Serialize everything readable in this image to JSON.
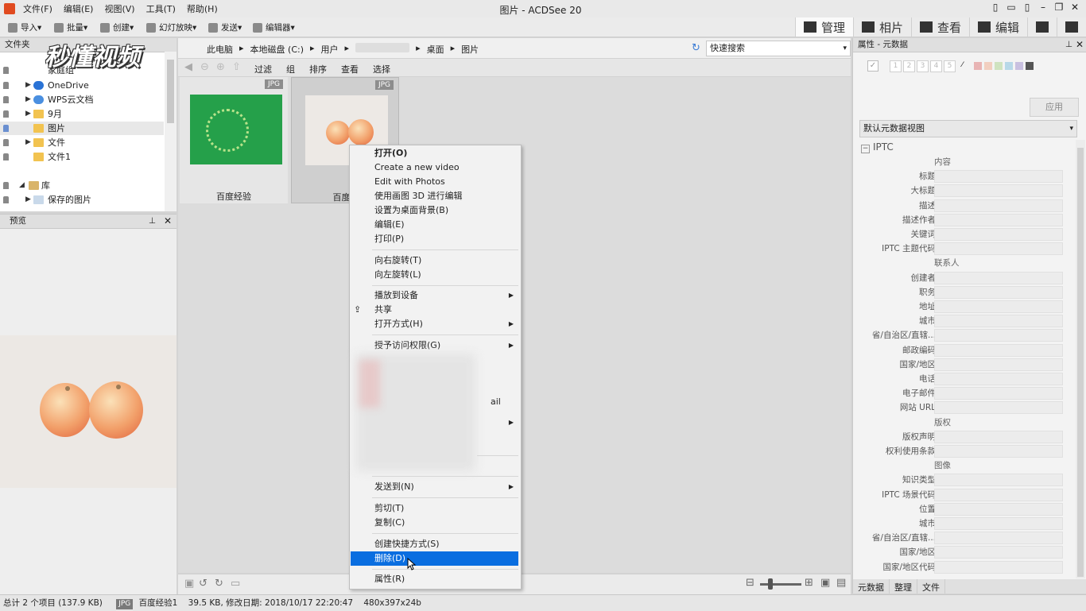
{
  "window": {
    "title": "图片 - ACDSee 20",
    "menu": [
      "文件(F)",
      "编辑(E)",
      "视图(V)",
      "工具(T)",
      "帮助(H)"
    ]
  },
  "toolbar": {
    "import": "导入",
    "batch": "批量",
    "create": "创建",
    "slideshow": "幻灯放映",
    "send": "发送",
    "editor": "编辑器"
  },
  "modes": [
    "管理",
    "相片",
    "查看",
    "编辑"
  ],
  "watermark": "秒懂视频",
  "folders": {
    "tab_label": "文件夹",
    "items": [
      "家庭组",
      "OneDrive",
      "WPS云文档",
      "9月",
      "图片",
      "文件",
      "文件1",
      "库",
      "保存的图片"
    ]
  },
  "preview": {
    "tab_label": "预览"
  },
  "breadcrumb": [
    "此电脑",
    "本地磁盘 (C:)",
    "用户",
    "桌面",
    "图片"
  ],
  "quick_search": "快速搜索",
  "filter_bar": [
    "过滤",
    "组",
    "排序",
    "查看",
    "选择"
  ],
  "thumbnails": [
    {
      "caption": "百度经验",
      "format": "JPG"
    },
    {
      "caption": "百度经",
      "format": "JPG"
    }
  ],
  "context_menu": {
    "group1": [
      "打开(O)",
      "Create a new video",
      "Edit with Photos",
      "使用画图 3D 进行编辑",
      "设置为桌面背景(B)",
      "编辑(E)",
      "打印(P)"
    ],
    "group2": [
      "向右旋转(T)",
      "向左旋转(L)"
    ],
    "group3": [
      "播放到设备",
      "共享",
      "打开方式(H)"
    ],
    "group4": [
      "授予访问权限(G)"
    ],
    "partial_text": "ail",
    "group5": [
      "发送到(N)"
    ],
    "group6": [
      "剪切(T)",
      "复制(C)"
    ],
    "group7": [
      "创建快捷方式(S)",
      "删除(D)"
    ],
    "group8": [
      "属性(R)"
    ],
    "highlighted": "删除(D)"
  },
  "properties": {
    "header": "属性 - 元数据",
    "rating": [
      "1",
      "2",
      "3",
      "4",
      "5"
    ],
    "color_labels": [
      "#e8b4b4",
      "#f2cfc0",
      "#cfe3c0",
      "#b8d8e8",
      "#c8c0e0",
      "#555555"
    ],
    "apply_button": "应用",
    "view_select": "默认元数据视图",
    "iptc_label": "IPTC",
    "fields": [
      {
        "section": "内容"
      },
      {
        "label": "标题"
      },
      {
        "label": "大标题"
      },
      {
        "label": "描述"
      },
      {
        "label": "描述作者"
      },
      {
        "label": "关键词"
      },
      {
        "label": "IPTC 主题代码"
      },
      {
        "section": "联系人"
      },
      {
        "label": "创建者"
      },
      {
        "label": "职务"
      },
      {
        "label": "地址"
      },
      {
        "label": "城市"
      },
      {
        "label": "省/自治区/直辖..."
      },
      {
        "label": "邮政编码"
      },
      {
        "label": "国家/地区"
      },
      {
        "label": "电话"
      },
      {
        "label": "电子邮件"
      },
      {
        "label": "网站 URL"
      },
      {
        "section": "版权"
      },
      {
        "label": "版权声明"
      },
      {
        "label": "权利使用条款"
      },
      {
        "section": "图像"
      },
      {
        "label": "知识类型"
      },
      {
        "label": "IPTC 场景代码"
      },
      {
        "label": "位置"
      },
      {
        "label": "城市"
      },
      {
        "label": "省/自治区/直辖..."
      },
      {
        "label": "国家/地区"
      },
      {
        "label": "国家/地区代码"
      }
    ],
    "bottom_tabs": [
      "元数据",
      "整理",
      "文件"
    ]
  },
  "status": {
    "total": "总计 2 个项目 (137.9 KB)",
    "format": "JPG",
    "filename": "百度经验1",
    "info": "39.5 KB, 修改日期: 2018/10/17 22:20:47",
    "dims": "480x397x24b"
  }
}
